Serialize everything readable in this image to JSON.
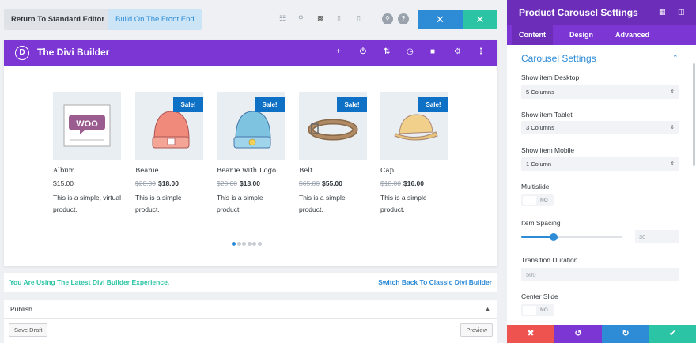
{
  "toolbar": {
    "return_label": "Return To Standard Editor",
    "front_label": "Build On The Front End",
    "icons": [
      "wireframe-icon",
      "zoom-icon",
      "desktop-icon",
      "tablet-icon",
      "phone-icon",
      "search-icon",
      "help-icon",
      "close-icon",
      "close-icon"
    ]
  },
  "builder": {
    "logo_letter": "D",
    "title": "The Divi Builder",
    "header_icons": [
      "add-icon",
      "power-icon",
      "sort-icon",
      "history-icon",
      "trash-icon",
      "gear-icon",
      "more-icon"
    ]
  },
  "products": [
    {
      "name": "Album",
      "old_price": "",
      "price": "$15.00",
      "desc": "This is a simple, virtual product.",
      "sale": false,
      "image": "woo-album"
    },
    {
      "name": "Beanie",
      "old_price": "$20.00",
      "price": "$18.00",
      "desc": "This is a simple product.",
      "sale": true,
      "sale_label": "Sale!",
      "image": "beanie"
    },
    {
      "name": "Beanie with Logo",
      "old_price": "$20.00",
      "price": "$18.00",
      "desc": "This is a simple product.",
      "sale": true,
      "sale_label": "Sale!",
      "image": "beanie-logo"
    },
    {
      "name": "Belt",
      "old_price": "$65.00",
      "price": "$55.00",
      "desc": "This is a simple product.",
      "sale": true,
      "sale_label": "Sale!",
      "image": "belt"
    },
    {
      "name": "Cap",
      "old_price": "$18.00",
      "price": "$16.00",
      "desc": "This is a simple product.",
      "sale": true,
      "sale_label": "Sale!",
      "image": "cap"
    }
  ],
  "carousel": {
    "dot_count": 6,
    "active_dot": 0
  },
  "notice": {
    "left": "You Are Using The Latest Divi Builder Experience.",
    "right": "Switch Back To Classic Divi Builder"
  },
  "publish": {
    "title": "Publish",
    "save_draft": "Save Draft",
    "preview": "Preview"
  },
  "panel": {
    "title": "Product Carousel Settings",
    "tabs": [
      "Content",
      "Design",
      "Advanced"
    ],
    "active_tab": "Content",
    "section_title": "Carousel Settings",
    "fields": {
      "desktop_label": "Show item Desktop",
      "desktop_value": "5 Columns",
      "tablet_label": "Show item Tablet",
      "tablet_value": "3 Columns",
      "mobile_label": "Show item Mobile",
      "mobile_value": "1 Column",
      "multislide_label": "Multislide",
      "multislide_value": "NO",
      "spacing_label": "Item Spacing",
      "spacing_value": "30",
      "spacing_fraction": 0.32,
      "duration_label": "Transition Duration",
      "duration_placeholder": "500",
      "center_label": "Center Slide",
      "center_value": "NO"
    },
    "footer_icons": [
      "discard-icon",
      "undo-icon",
      "redo-icon",
      "save-check-icon"
    ]
  },
  "colors": {
    "purple_header": "#7b36d3",
    "panel_header": "#6c2eb9",
    "blue": "#2e8bd6",
    "green": "#2bc4a4",
    "red": "#ef5350",
    "sale_blue": "#0f71c6"
  }
}
